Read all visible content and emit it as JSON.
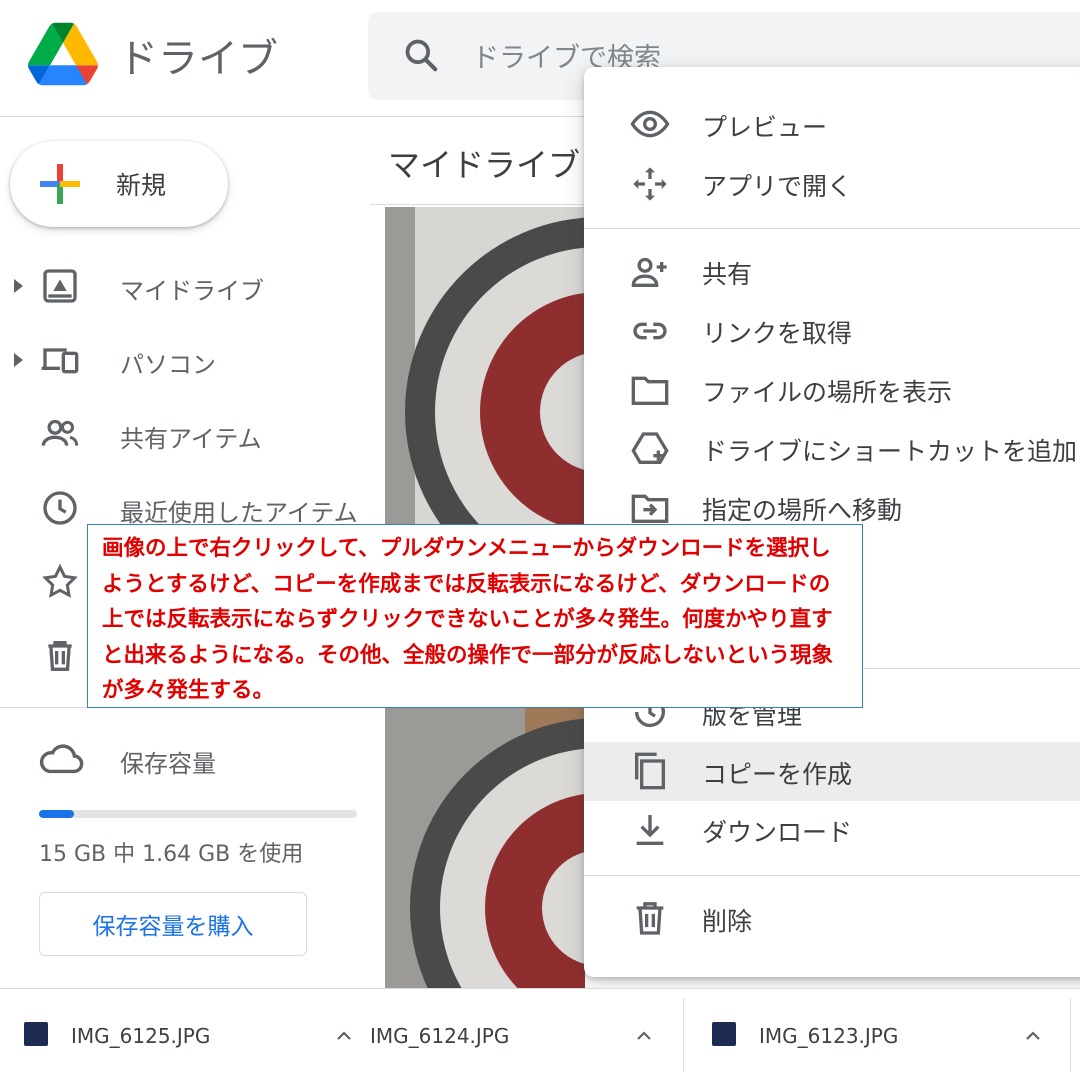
{
  "header": {
    "app_name": "ドライブ",
    "search_placeholder": "ドライブで検索"
  },
  "sidebar": {
    "new_label": "新規",
    "items": [
      {
        "label": "マイドライブ"
      },
      {
        "label": "パソコン"
      },
      {
        "label": "共有アイテム"
      },
      {
        "label": "最近使用したアイテム"
      }
    ],
    "storage_label": "保存容量",
    "storage_usage": "15 GB 中 1.64 GB を使用",
    "storage_used_fraction": 0.109,
    "buy_storage": "保存容量を購入"
  },
  "main": {
    "title": "マイドライブ"
  },
  "context_menu": {
    "items": [
      {
        "label": "プレビュー",
        "icon": "eye-icon"
      },
      {
        "label": "アプリで開く",
        "icon": "open-with-icon"
      },
      {
        "label": "共有",
        "icon": "person-add-icon"
      },
      {
        "label": "リンクを取得",
        "icon": "link-icon"
      },
      {
        "label": "ファイルの場所を表示",
        "icon": "folder-icon"
      },
      {
        "label": "ドライブにショートカットを追加",
        "icon": "add-shortcut-icon"
      },
      {
        "label": "指定の場所へ移動",
        "icon": "move-to-icon"
      },
      {
        "label": "版を管理",
        "icon": "history-icon"
      },
      {
        "label": "コピーを作成",
        "icon": "copy-icon",
        "highlighted": true
      },
      {
        "label": "ダウンロード",
        "icon": "download-icon"
      },
      {
        "label": "削除",
        "icon": "trash-icon"
      }
    ]
  },
  "annotation": {
    "text": "画像の上で右クリックして、プルダウンメニューからダウンロードを選択しようとするけど、コピーを作成までは反転表示になるけど、ダウンロードの上では反転表示にならずクリックできないことが多々発生。何度かやり直すと出来るようになる。その他、全般の操作で一部分が反応しないという現象が多々発生する。"
  },
  "downloads": [
    {
      "name": "IMG_6125.JPG"
    },
    {
      "name": "IMG_6124.JPG"
    },
    {
      "name": "IMG_6123.JPG"
    }
  ],
  "colors": {
    "annotation_text": "#e00000",
    "annotation_border": "#3a7fb8",
    "accent": "#1a73e8"
  }
}
